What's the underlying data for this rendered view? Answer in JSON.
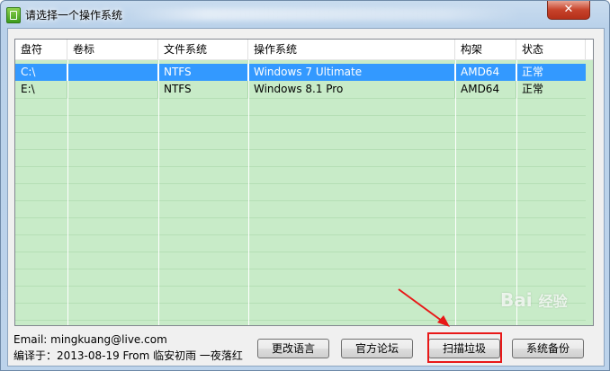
{
  "window": {
    "title": "请选择一个操作系统",
    "close_glyph": "✕"
  },
  "table": {
    "columns": [
      "盘符",
      "卷标",
      "文件系统",
      "操作系统",
      "构架",
      "状态"
    ],
    "rows": [
      {
        "drive": "C:\\",
        "label": "",
        "fs": "NTFS",
        "os": "Windows 7 Ultimate",
        "arch": "AMD64",
        "status": "正常",
        "selected": true
      },
      {
        "drive": "E:\\",
        "label": "",
        "fs": "NTFS",
        "os": "Windows 8.1 Pro",
        "arch": "AMD64",
        "status": "正常",
        "selected": false
      }
    ]
  },
  "footer": {
    "email": "Email: mingkuang@live.com",
    "credit": "编译于：2013-08-19 From 临安初雨 一夜落红"
  },
  "buttons": {
    "language": "更改语言",
    "forum": "官方论坛",
    "scan": "扫描垃圾",
    "backup": "系统备份"
  },
  "watermark": "Bai 经验",
  "colors": {
    "list_bg": "#c8ebc8",
    "selection": "#3399ff",
    "annotation": "#e81818"
  },
  "icons": {
    "app": "app-icon",
    "close": "close-icon",
    "arrow": "annotation-arrow-icon"
  }
}
